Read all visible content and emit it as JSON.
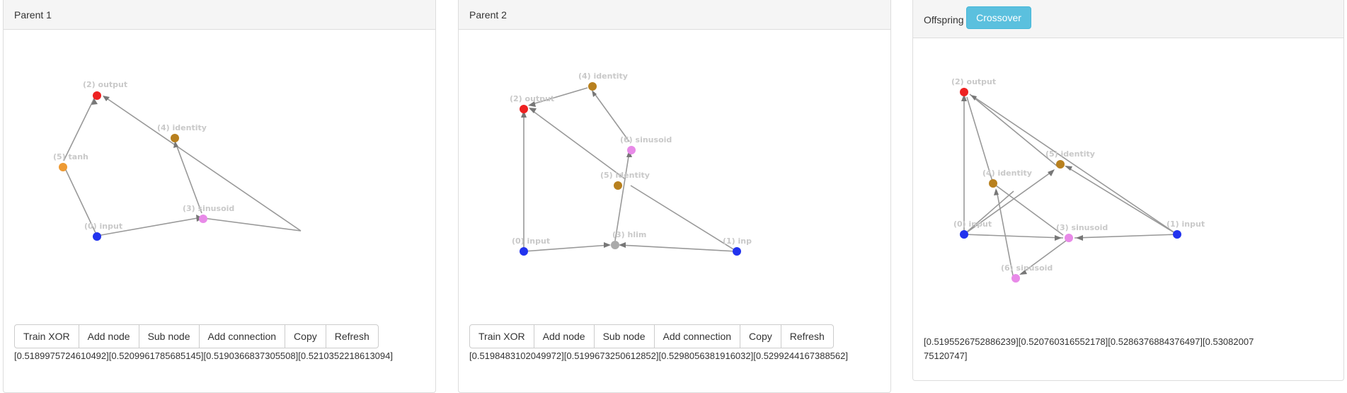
{
  "panels": {
    "parent1": {
      "title": "Parent 1",
      "nodes": [
        {
          "label": "(2) output",
          "color": "#ee2222"
        },
        {
          "label": "(4) identity",
          "color": "#b8801e"
        },
        {
          "label": "(5) tanh",
          "color": "#ee9a33"
        },
        {
          "label": "(3) sinusoid",
          "color": "#e88ae8"
        },
        {
          "label": "(0) input",
          "color": "#2233ee"
        }
      ],
      "outputs": "[0.5189975724610492][0.5209961785685145][0.5190366837305508][0.5210352218613094]"
    },
    "parent2": {
      "title": "Parent 2",
      "nodes": [
        {
          "label": "(4) identity",
          "color": "#b8801e"
        },
        {
          "label": "(2) output",
          "color": "#ee2222"
        },
        {
          "label": "(6) sinusoid",
          "color": "#e88ae8"
        },
        {
          "label": "(5) identity",
          "color": "#b8801e"
        },
        {
          "label": "(0) input",
          "color": "#2233ee"
        },
        {
          "label": "(3) hlim",
          "color": "#aaaaaa"
        },
        {
          "label": "(1) inp",
          "color": "#2233ee"
        }
      ],
      "outputs": "[0.5198483102049972][0.5199673250612852][0.5298056381916032][0.5299244167388562]"
    },
    "offspring": {
      "title": "Offspring",
      "crossover_label": "Crossover",
      "nodes": [
        {
          "label": "(2) output",
          "color": "#ee2222"
        },
        {
          "label": "(5) identity",
          "color": "#b8801e"
        },
        {
          "label": "(4) identity",
          "color": "#b8801e"
        },
        {
          "label": "(0) input",
          "color": "#2233ee"
        },
        {
          "label": "(3) sinusoid",
          "color": "#e88ae8"
        },
        {
          "label": "(1) input",
          "color": "#2233ee"
        },
        {
          "label": "(6) sinusoid",
          "color": "#e88ae8"
        }
      ],
      "outputs": "[0.5195526752886239][0.520760316552178][0.5286376884376497][0.5308200775120747]"
    }
  },
  "buttons": {
    "train_xor": "Train XOR",
    "add_node": "Add node",
    "sub_node": "Sub node",
    "add_connection": "Add connection",
    "copy": "Copy",
    "refresh": "Refresh"
  }
}
